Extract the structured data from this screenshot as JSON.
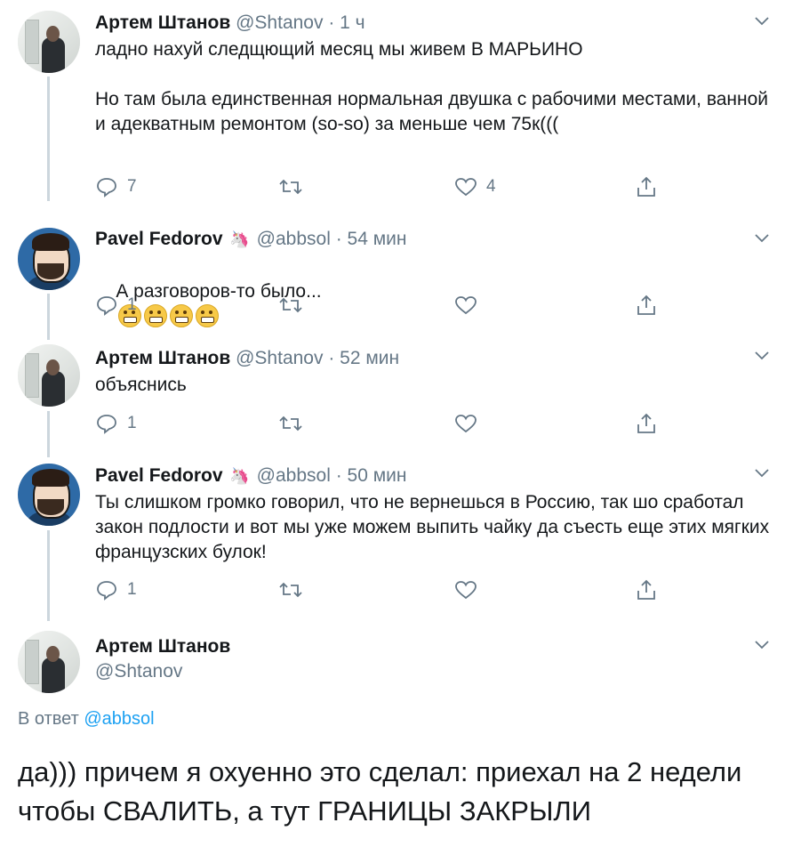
{
  "tweets": [
    {
      "name": "Артем Штанов",
      "handle": "@Shtanov",
      "time": "1 ч",
      "text": "ладно нахуй следщющий месяц мы живем В МАРЬИНО\n\nНо там была единственная нормальная двушка с рабочими местами, ванной и адекватным ремонтом (so-so) за меньше чем 75к(((",
      "replies": "7",
      "retweets": "",
      "likes": "4"
    },
    {
      "name": "Pavel Fedorov",
      "badge": "unicorn-emoji",
      "handle": "@abbsol",
      "time": "54 мин",
      "text": "А разговоров-то было...",
      "emoji": "grimacing-face-emoji",
      "replies": "1",
      "retweets": "",
      "likes": ""
    },
    {
      "name": "Артем Штанов",
      "handle": "@Shtanov",
      "time": "52 мин",
      "text": "объяснись",
      "replies": "1",
      "retweets": "",
      "likes": ""
    },
    {
      "name": "Pavel Fedorov",
      "badge": "unicorn-emoji",
      "handle": "@abbsol",
      "time": "50 мин",
      "text": "Ты слишком громко говорил, что не вернешься в Россию, так шо сработал закон подлости и вот мы уже можем выпить чайку да съесть еще этих мягких французских булок!",
      "replies": "1",
      "retweets": "",
      "likes": ""
    }
  ],
  "main_tweet": {
    "name": "Артем Штанов",
    "handle": "@Shtanov",
    "reply_prefix": "В ответ",
    "reply_mention": "@abbsol",
    "text": "да))) причем я охуенно это сделал: приехал на 2 недели чтобы СВАЛИТЬ, а тут ГРАНИЦЫ ЗАКРЫЛИ"
  },
  "separator": " · ",
  "icons": {
    "reply": "speech-bubble-icon",
    "retweet": "retweet-arrows-icon",
    "like": "heart-icon",
    "share": "share-upload-icon",
    "more": "chevron-down-icon"
  },
  "colors": {
    "text": "#14171a",
    "meta": "#657786",
    "link": "#1da1f2",
    "thread_line": "#ccd6dd"
  }
}
